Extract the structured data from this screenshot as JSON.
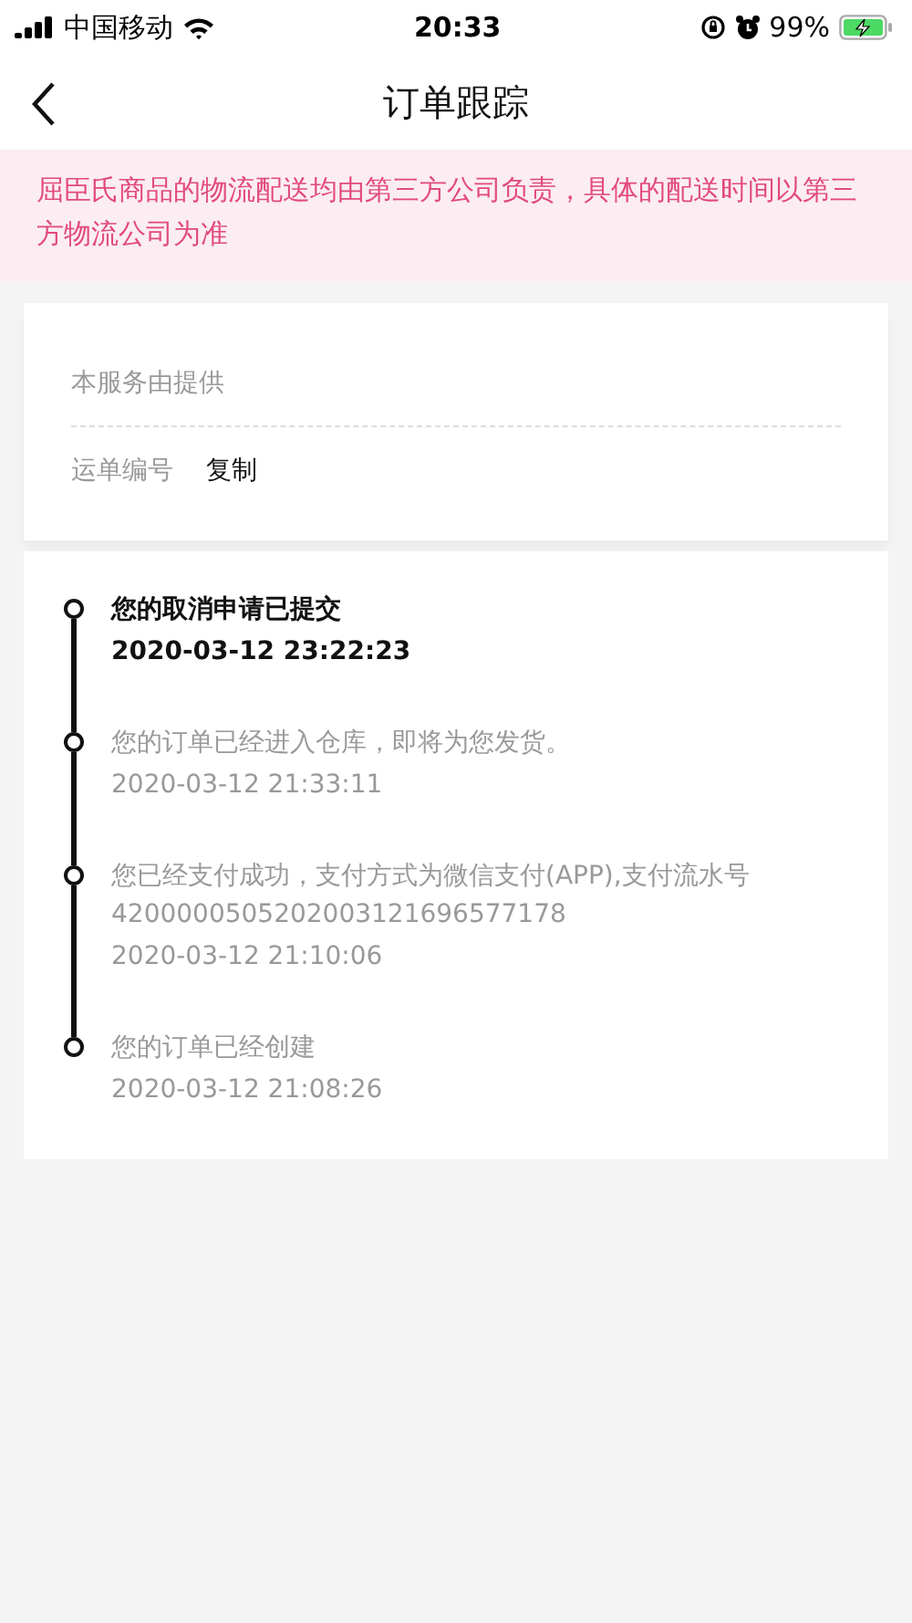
{
  "status_bar": {
    "carrier": "中国移动",
    "time": "20:33",
    "battery": "99%",
    "charging": true
  },
  "nav": {
    "title": "订单跟踪"
  },
  "notice": "屈臣氏商品的物流配送均由第三方公司负责，具体的配送时间以第三方物流公司为准",
  "shipping": {
    "provider_label": "本服务由提供",
    "waybill_label": "运单编号",
    "copy_button": "复制"
  },
  "timeline": [
    {
      "lines": [
        "您的取消申请已提交"
      ],
      "time": "2020-03-12 23:22:23",
      "current": true
    },
    {
      "lines": [
        "您的订单已经进入仓库，即将为您发货。"
      ],
      "time": "2020-03-12 21:33:11",
      "current": false
    },
    {
      "lines": [
        "您已经支付成功，支付方式为微信支付(APP),支付流水号",
        "4200000505202003121696577178"
      ],
      "time": "2020-03-12 21:10:06",
      "current": false
    },
    {
      "lines": [
        "您的订单已经创建"
      ],
      "time": "2020-03-12 21:08:26",
      "current": false
    }
  ]
}
